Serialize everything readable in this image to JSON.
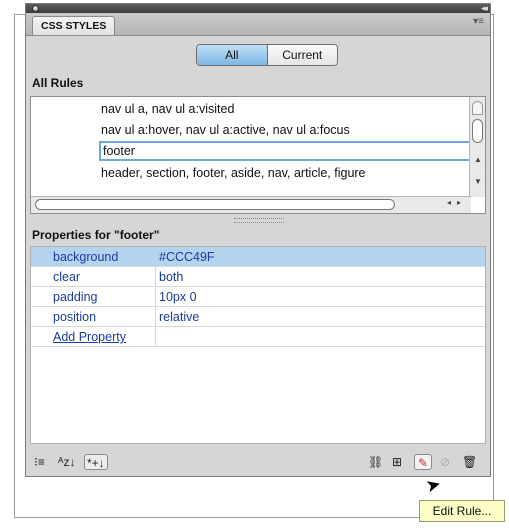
{
  "panel": {
    "tab_label": "CSS STYLES",
    "collapse_glyph": "◂◂",
    "options_glyph": "▾≡"
  },
  "mode_toggle": {
    "all_label": "All",
    "current_label": "Current",
    "selected": "All"
  },
  "rules_section": {
    "heading": "All Rules",
    "rules": [
      {
        "text": "nav ul a, nav ul a:visited"
      },
      {
        "text": "nav ul a:hover, nav ul a:active, nav ul a:focus"
      },
      {
        "text": "footer"
      },
      {
        "text": "header, section, footer, aside, nav, article, figure"
      }
    ],
    "selected_index": 2
  },
  "properties_section": {
    "heading": "Properties for \"footer\"",
    "rows": [
      {
        "name": "background",
        "value": "#CCC49F",
        "selected": true
      },
      {
        "name": "clear",
        "value": "both"
      },
      {
        "name": "padding",
        "value": "10px 0"
      },
      {
        "name": "position",
        "value": "relative"
      }
    ],
    "add_property_label": "Add Property"
  },
  "toolbar": {
    "left_icons": [
      {
        "name": "category-view-icon",
        "glyph": "⁝≡"
      },
      {
        "name": "alphabetical-view-icon",
        "glyph": "ᴬz↓"
      },
      {
        "name": "set-properties-view-icon",
        "glyph": "*+↓"
      }
    ],
    "right_icons": [
      {
        "name": "attach-style-sheet-icon",
        "glyph": "⛓"
      },
      {
        "name": "new-css-rule-icon",
        "glyph": "⊞"
      },
      {
        "name": "edit-rule-icon",
        "glyph": "✎"
      },
      {
        "name": "disable-property-icon",
        "glyph": "⊘"
      },
      {
        "name": "delete-icon",
        "glyph": "🗑"
      }
    ]
  },
  "tooltip": {
    "text": "Edit Rule..."
  },
  "colors": {
    "panel_bg": "#d6d6d6",
    "selection_blue": "#b5d2ee",
    "property_text": "#1a3c9c",
    "tooltip_bg": "#fdfdc8"
  }
}
